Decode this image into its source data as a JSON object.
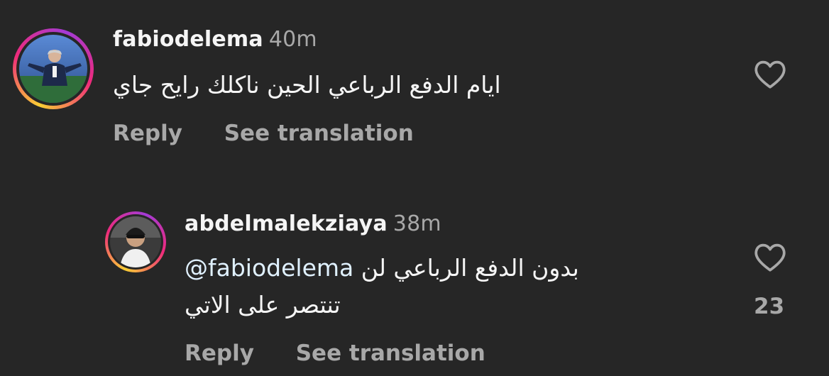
{
  "comments": [
    {
      "username": "fabiodelema",
      "time": "40m",
      "text": "ايام الدفع الرباعي الحين ناكلك رايح جاي",
      "reply_label": "Reply",
      "translate_label": "See translation"
    },
    {
      "username": "abdelmalekziaya",
      "time": "38m",
      "mention": "@fabiodelema",
      "text_line1": "بدون الدفع الرباعي لن",
      "text_line2": "تنتصر على الاتي",
      "likes": "23",
      "reply_label": "Reply",
      "translate_label": "See translation"
    }
  ],
  "colors": {
    "background": "#262626",
    "muted": "#a8a8a8",
    "text": "#f5f5f5",
    "mention": "#e0f1ff"
  },
  "icons": [
    "heart-outline-icon"
  ]
}
